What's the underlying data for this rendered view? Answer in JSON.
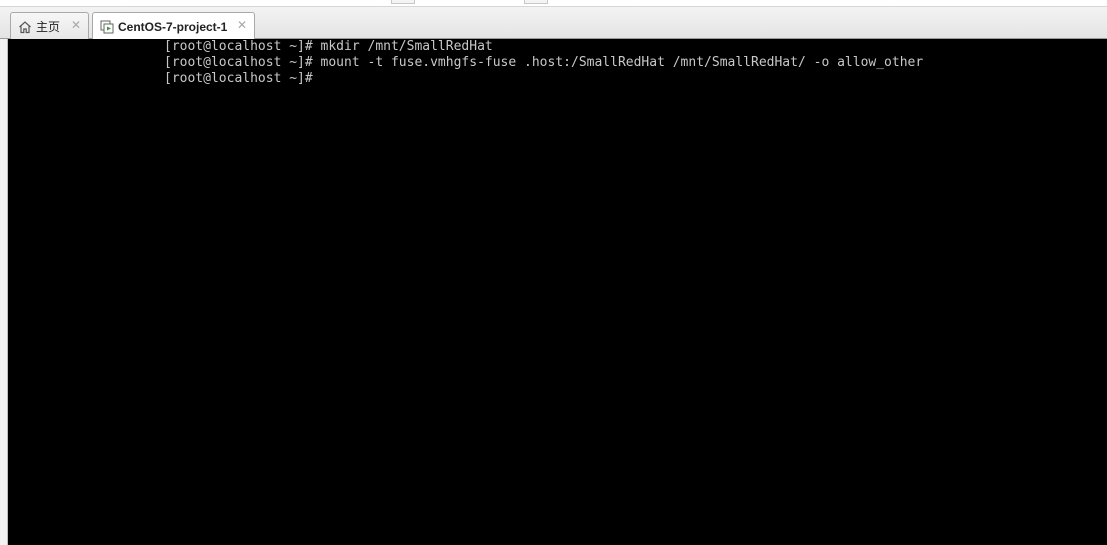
{
  "tabs": {
    "home": {
      "label": "主页",
      "icon": "home-icon",
      "close_glyph": "✕"
    },
    "vm": {
      "label": "CentOS-7-project-1",
      "icon": "vm-console-icon",
      "close_glyph": "✕"
    }
  },
  "console": {
    "lines": [
      "[root@localhost ~]# mkdir /mnt/SmallRedHat",
      "[root@localhost ~]# mount -t fuse.vmhgfs-fuse .host:/SmallRedHat /mnt/SmallRedHat/ -o allow_other",
      "[root@localhost ~]#"
    ],
    "background": "#000000",
    "text_color": "#c8c8c8"
  }
}
